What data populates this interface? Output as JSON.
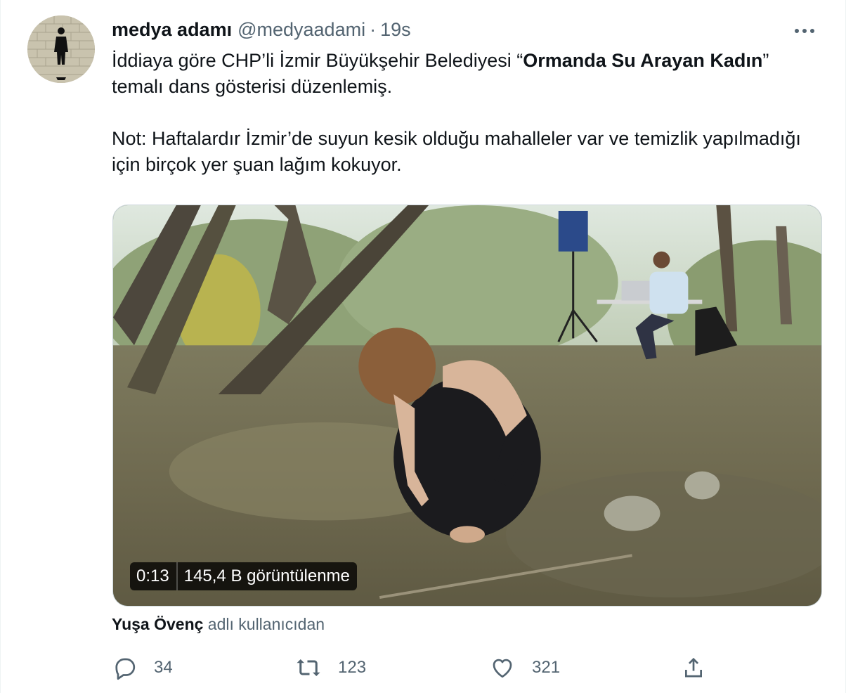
{
  "author": {
    "display_name": "medya adamı",
    "handle": "@medyaadami",
    "separator": "·",
    "time": "19s"
  },
  "tweet": {
    "line1_prefix": "İddiaya göre CHP’li İzmir Büyükşehir Belediyesi “",
    "line1_bold": "Ormanda Su Arayan Kadın",
    "line1_suffix": "” temalı dans gösterisi düzenlemiş.",
    "line2": "Not: Haftalardır İzmir’de suyun kesik olduğu mahalleler var ve temizlik yapılmadığı için birçok yer şuan lağım kokuyor."
  },
  "media": {
    "duration": "0:13",
    "views": "145,4 B görüntülenme"
  },
  "attribution": {
    "user": "Yuşa Övenç",
    "suffix": " adlı kullanıcıdan"
  },
  "actions": {
    "reply_count": "34",
    "retweet_count": "123",
    "like_count": "321"
  },
  "icons": {
    "more": "more-icon",
    "reply": "reply-icon",
    "retweet": "retweet-icon",
    "like": "heart-icon",
    "share": "share-icon"
  },
  "colors": {
    "text_primary": "#0f1419",
    "text_secondary": "#536471",
    "border": "#cfd9de"
  }
}
